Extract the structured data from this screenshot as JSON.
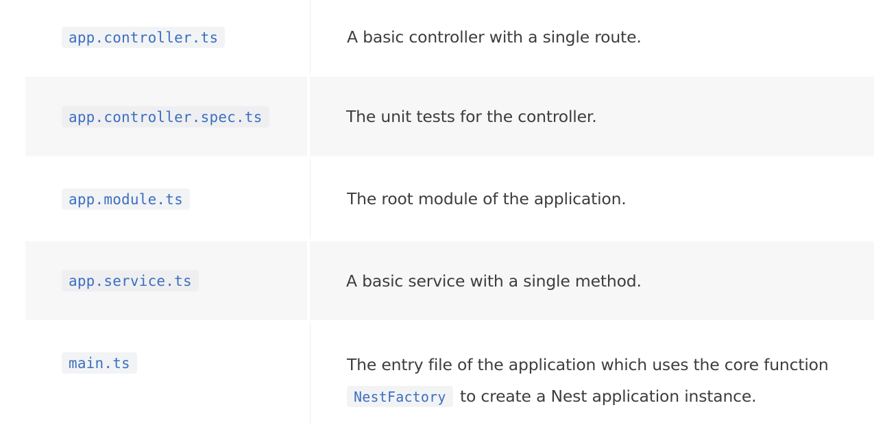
{
  "rows": [
    {
      "file": "app.controller.ts",
      "description": "A basic controller with a single route."
    },
    {
      "file": "app.controller.spec.ts",
      "description": "The unit tests for the controller."
    },
    {
      "file": "app.module.ts",
      "description": "The root module of the application."
    },
    {
      "file": "app.service.ts",
      "description": "A basic service with a single method."
    },
    {
      "file": "main.ts",
      "description_before": "The entry file of the application which uses the core function",
      "description_code": "NestFactory",
      "description_after": "to create a Nest application instance."
    }
  ]
}
